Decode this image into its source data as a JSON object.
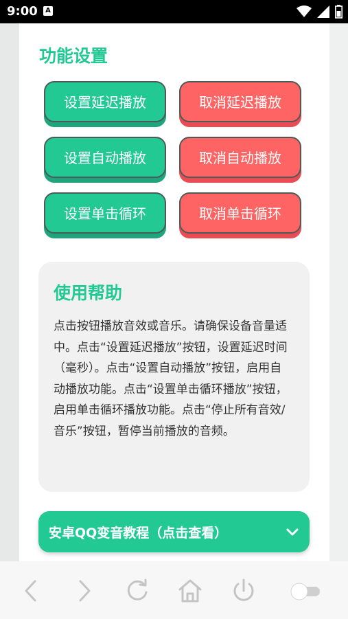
{
  "status_bar": {
    "time": "9:00",
    "notification_icon": "a-icon",
    "icons": [
      "wifi-icon",
      "signal-icon",
      "battery-icon"
    ]
  },
  "settings": {
    "title": "功能设置",
    "buttons": [
      {
        "label": "设置延迟播放",
        "color": "#22c993"
      },
      {
        "label": "取消延迟播放",
        "color": "#fe6464"
      },
      {
        "label": "设置自动播放",
        "color": "#22c993"
      },
      {
        "label": "取消自动播放",
        "color": "#fe6464"
      },
      {
        "label": "设置单击循环",
        "color": "#22c993"
      },
      {
        "label": "取消单击循环",
        "color": "#fe6464"
      }
    ]
  },
  "help": {
    "title": "使用帮助",
    "text": "点击按钮播放音效或音乐。请确保设备音量适中。点击“设置延迟播放”按钮，设置延迟时间（毫秒）。点击“设置自动播放”按钮，启用自动播放功能。点击“设置单击循环播放”按钮，启用单击循环播放功能。点击“停止所有音效/音乐”按钮，暂停当前播放的音频。"
  },
  "tutorial": {
    "label": "安卓QQ变音教程（点击查看）",
    "icon": "chevron-down-icon"
  },
  "bottom_nav": {
    "icons": [
      "back-icon",
      "forward-icon",
      "refresh-icon",
      "home-icon",
      "power-icon",
      "toggle-switch"
    ],
    "toggle_on": false
  },
  "colors": {
    "accent_green": "#22c993",
    "accent_red": "#fe6464"
  }
}
